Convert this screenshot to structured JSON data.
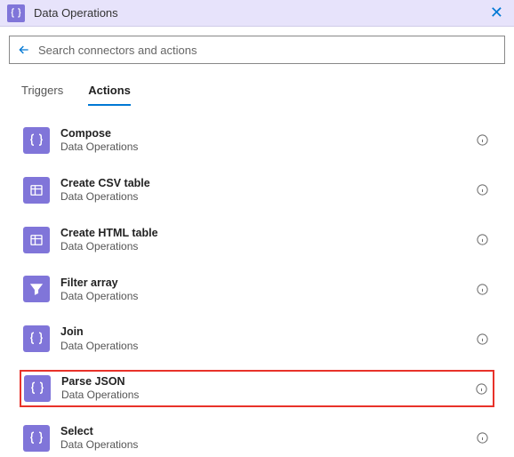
{
  "header": {
    "title": "Data Operations",
    "icon": "braces-icon"
  },
  "search": {
    "placeholder": "Search connectors and actions",
    "value": ""
  },
  "tabs": [
    {
      "label": "Triggers",
      "active": false
    },
    {
      "label": "Actions",
      "active": true
    }
  ],
  "actions": [
    {
      "title": "Compose",
      "subtitle": "Data Operations",
      "icon": "braces",
      "highlighted": false
    },
    {
      "title": "Create CSV table",
      "subtitle": "Data Operations",
      "icon": "table",
      "highlighted": false
    },
    {
      "title": "Create HTML table",
      "subtitle": "Data Operations",
      "icon": "table",
      "highlighted": false
    },
    {
      "title": "Filter array",
      "subtitle": "Data Operations",
      "icon": "filter",
      "highlighted": false
    },
    {
      "title": "Join",
      "subtitle": "Data Operations",
      "icon": "braces",
      "highlighted": false
    },
    {
      "title": "Parse JSON",
      "subtitle": "Data Operations",
      "icon": "braces",
      "highlighted": true
    },
    {
      "title": "Select",
      "subtitle": "Data Operations",
      "icon": "braces",
      "highlighted": false
    }
  ],
  "colors": {
    "accent": "#0078d4",
    "connector": "#8075d9",
    "header_bg": "#e7e3fb",
    "highlight_border": "#e8322a"
  }
}
